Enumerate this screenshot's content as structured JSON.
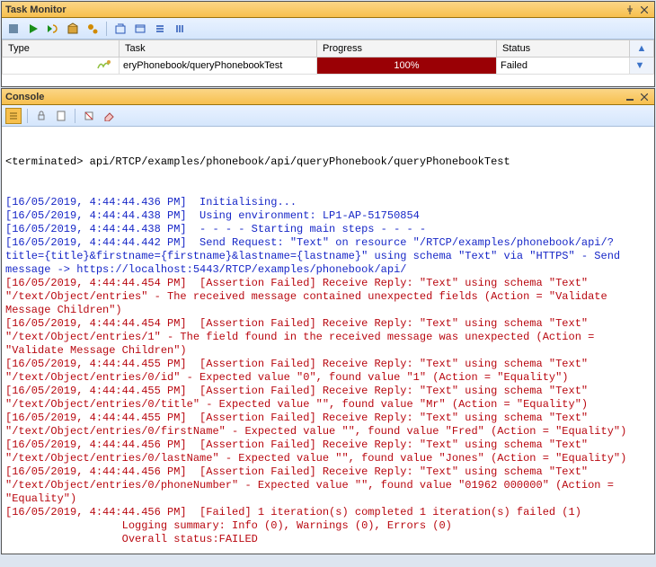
{
  "taskMonitor": {
    "title": "Task Monitor",
    "columns": {
      "type": "Type",
      "task": "Task",
      "progress": "Progress",
      "status": "Status"
    },
    "row": {
      "task": "eryPhonebook/queryPhonebookTest",
      "progress": "100%",
      "status": "Failed"
    }
  },
  "console": {
    "title": "Console",
    "header": "<terminated> api/RTCP/examples/phonebook/api/queryPhonebook/queryPhonebookTest",
    "lines": [
      {
        "cls": "c-blue",
        "text": "[16/05/2019, 4:44:44.436 PM]  Initialising..."
      },
      {
        "cls": "c-blue",
        "text": "[16/05/2019, 4:44:44.438 PM]  Using environment: LP1-AP-51750854"
      },
      {
        "cls": "c-blue",
        "text": "[16/05/2019, 4:44:44.438 PM]  - - - - Starting main steps - - - -"
      },
      {
        "cls": "c-blue",
        "text": "[16/05/2019, 4:44:44.442 PM]  Send Request: \"Text\" on resource \"/RTCP/examples/phonebook/api/?title={title}&firstname={firstname}&lastname={lastname}\" using schema \"Text\" via \"HTTPS\" - Send message -> https://localhost:5443/RTCP/examples/phonebook/api/"
      },
      {
        "cls": "c-red",
        "text": "[16/05/2019, 4:44:44.454 PM]  [Assertion Failed] Receive Reply: \"Text\" using schema \"Text\" \"/text/Object/entries\" - The received message contained unexpected fields (Action = \"Validate Message Children\")"
      },
      {
        "cls": "c-red",
        "text": "[16/05/2019, 4:44:44.454 PM]  [Assertion Failed] Receive Reply: \"Text\" using schema \"Text\" \"/text/Object/entries/1\" - The field found in the received message was unexpected (Action = \"Validate Message Children\")"
      },
      {
        "cls": "c-red",
        "text": "[16/05/2019, 4:44:44.455 PM]  [Assertion Failed] Receive Reply: \"Text\" using schema \"Text\" \"/text/Object/entries/0/id\" - Expected value \"0\", found value \"1\" (Action = \"Equality\")"
      },
      {
        "cls": "c-red",
        "text": "[16/05/2019, 4:44:44.455 PM]  [Assertion Failed] Receive Reply: \"Text\" using schema \"Text\" \"/text/Object/entries/0/title\" - Expected value \"\", found value \"Mr\" (Action = \"Equality\")"
      },
      {
        "cls": "c-red",
        "text": "[16/05/2019, 4:44:44.455 PM]  [Assertion Failed] Receive Reply: \"Text\" using schema \"Text\" \"/text/Object/entries/0/firstName\" - Expected value \"\", found value \"Fred\" (Action = \"Equality\")"
      },
      {
        "cls": "c-red",
        "text": "[16/05/2019, 4:44:44.456 PM]  [Assertion Failed] Receive Reply: \"Text\" using schema \"Text\" \"/text/Object/entries/0/lastName\" - Expected value \"\", found value \"Jones\" (Action = \"Equality\")"
      },
      {
        "cls": "c-red",
        "text": "[16/05/2019, 4:44:44.456 PM]  [Assertion Failed] Receive Reply: \"Text\" using schema \"Text\" \"/text/Object/entries/0/phoneNumber\" - Expected value \"\", found value \"01962 000000\" (Action = \"Equality\")"
      },
      {
        "cls": "c-red",
        "text": "[16/05/2019, 4:44:44.456 PM]  [Failed] 1 iteration(s) completed 1 iteration(s) failed (1)"
      },
      {
        "cls": "c-red",
        "text": "                  Logging summary: Info (0), Warnings (0), Errors (0)"
      },
      {
        "cls": "c-red",
        "text": "                  Overall status:FAILED"
      }
    ]
  }
}
